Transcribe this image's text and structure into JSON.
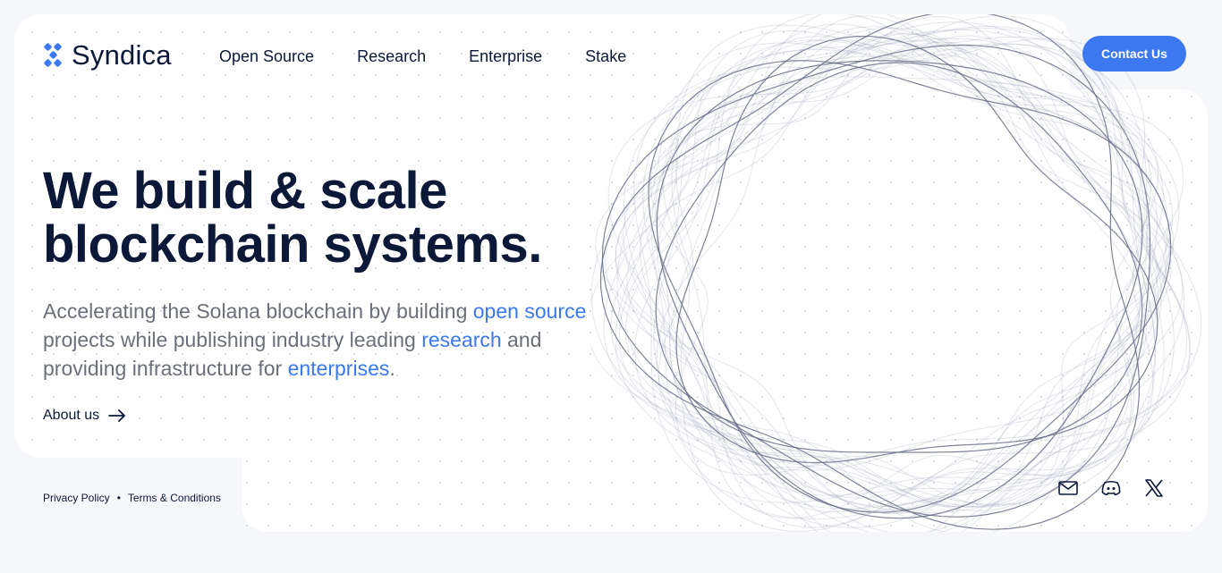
{
  "brand": {
    "name": "Syndica",
    "accent": "#3c78f0",
    "text_dark": "#0c1838"
  },
  "nav": {
    "items": [
      {
        "label": "Open Source"
      },
      {
        "label": "Research"
      },
      {
        "label": "Enterprise"
      },
      {
        "label": "Stake"
      }
    ],
    "contact_label": "Contact Us"
  },
  "hero": {
    "headline": "We build & scale blockchain systems.",
    "sub": {
      "part1": "Accelerating the Solana blockchain by building ",
      "link1": "open source",
      "part2": " projects while publishing industry leading ",
      "link2": "research",
      "part3": " and providing infrastructure for ",
      "link3": "enterprises",
      "part4": "."
    },
    "about_label": "About us"
  },
  "footer": {
    "privacy": "Privacy Policy",
    "separator": "•",
    "terms": "Terms & Conditions",
    "socials": [
      "mail-icon",
      "discord-icon",
      "x-icon"
    ]
  }
}
